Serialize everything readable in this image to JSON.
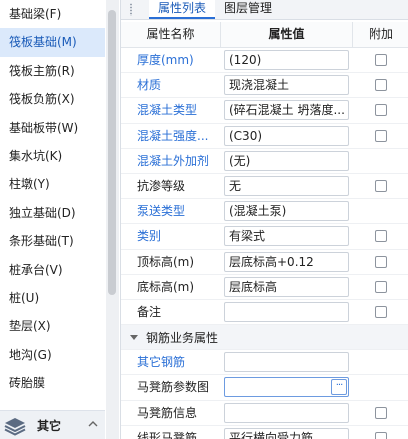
{
  "nav": {
    "items": [
      {
        "label": "基础梁(F)"
      },
      {
        "label": "筏板基础(M)",
        "selected": true
      },
      {
        "label": "筏板主筋(R)"
      },
      {
        "label": "筏板负筋(X)"
      },
      {
        "label": "基础板带(W)"
      },
      {
        "label": "集水坑(K)"
      },
      {
        "label": "柱墩(Y)"
      },
      {
        "label": "独立基础(D)"
      },
      {
        "label": "条形基础(T)"
      },
      {
        "label": "桩承台(V)"
      },
      {
        "label": "桩(U)"
      },
      {
        "label": "垫层(X)"
      },
      {
        "label": "地沟(G)"
      },
      {
        "label": "砖胎膜"
      }
    ],
    "footer": {
      "label": "其它",
      "icon": "layers-icon"
    }
  },
  "tabs": {
    "property_list": "属性列表",
    "layer_manage": "图层管理"
  },
  "table": {
    "headers": {
      "name": "属性名称",
      "value": "属性值",
      "extra": "附加"
    },
    "rows": [
      {
        "name": "厚度(mm)",
        "value": "(120)",
        "blue": true,
        "checkbox": true
      },
      {
        "name": "材质",
        "value": "现浇混凝土",
        "blue": true,
        "checkbox": true
      },
      {
        "name": "混凝土类型",
        "value": "(碎石混凝土 坍落度...",
        "blue": true,
        "checkbox": true
      },
      {
        "name": "混凝土强度...",
        "value": "(C30)",
        "blue": true,
        "checkbox": true
      },
      {
        "name": "混凝土外加剂",
        "value": "(无)",
        "blue": true,
        "checkbox": false
      },
      {
        "name": "抗渗等级",
        "value": "无",
        "blue": false,
        "checkbox": true
      },
      {
        "name": "泵送类型",
        "value": "(混凝土泵)",
        "blue": true,
        "checkbox": false
      },
      {
        "name": "类别",
        "value": "有梁式",
        "blue": true,
        "checkbox": true
      },
      {
        "name": "顶标高(m)",
        "value": "层底标高+0.12",
        "blue": false,
        "checkbox": true
      },
      {
        "name": "底标高(m)",
        "value": "层底标高",
        "blue": false,
        "checkbox": true
      },
      {
        "name": "备注",
        "value": "",
        "blue": false,
        "checkbox": true
      }
    ],
    "section": {
      "title": "钢筋业务属性"
    },
    "rebar_rows": [
      {
        "name": "其它钢筋",
        "value": "",
        "blue": true,
        "checkbox": false
      },
      {
        "name": "马凳筋参数图",
        "value": "",
        "blue": false,
        "checkbox": false,
        "active": true,
        "button": "···"
      },
      {
        "name": "马凳筋信息",
        "value": "",
        "blue": false,
        "checkbox": true
      },
      {
        "name": "线形马凳筋...",
        "value": "平行横向受力筋",
        "blue": false,
        "checkbox": true
      }
    ]
  }
}
